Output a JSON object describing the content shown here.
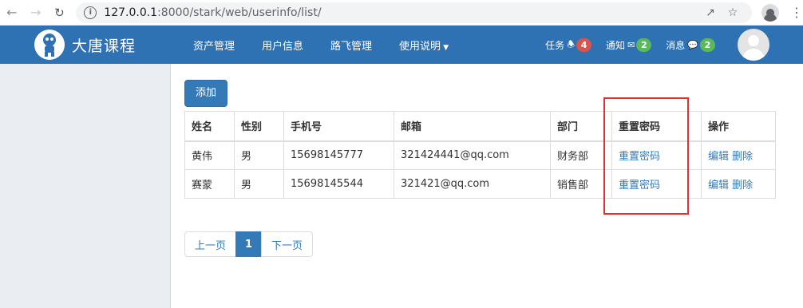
{
  "browser": {
    "url_host": "127.0.0.1",
    "url_rest": ":8000/stark/web/userinfo/list/"
  },
  "navbar": {
    "brand": "大唐课程",
    "menu": [
      "资产管理",
      "用户信息",
      "路飞管理",
      "使用说明"
    ],
    "notifications": [
      {
        "label": "任务",
        "icon": "bell-icon",
        "count": "4",
        "color": "#d9534f"
      },
      {
        "label": "通知",
        "icon": "envelope-icon",
        "count": "2",
        "color": "#5cb85c"
      },
      {
        "label": "消息",
        "icon": "comment-icon",
        "count": "2",
        "color": "#5cb85c"
      }
    ]
  },
  "main": {
    "add_button": "添加",
    "table": {
      "headers": [
        "姓名",
        "性别",
        "手机号",
        "邮箱",
        "部门",
        "重置密码",
        "操作"
      ],
      "rows": [
        {
          "name": "黄伟",
          "gender": "男",
          "phone": "15698145777",
          "email": "321424441@qq.com",
          "dept": "财务部",
          "reset": "重置密码",
          "edit": "编辑",
          "delete": "删除"
        },
        {
          "name": "赛蒙",
          "gender": "男",
          "phone": "15698145544",
          "email": "321421@qq.com",
          "dept": "销售部",
          "reset": "重置密码",
          "edit": "编辑",
          "delete": "删除"
        }
      ]
    },
    "pagination": {
      "prev": "上一页",
      "current": "1",
      "next": "下一页"
    }
  },
  "colors": {
    "navbar": "#2f72b4",
    "primary": "#337ab7",
    "highlight_box": "#e03030"
  }
}
